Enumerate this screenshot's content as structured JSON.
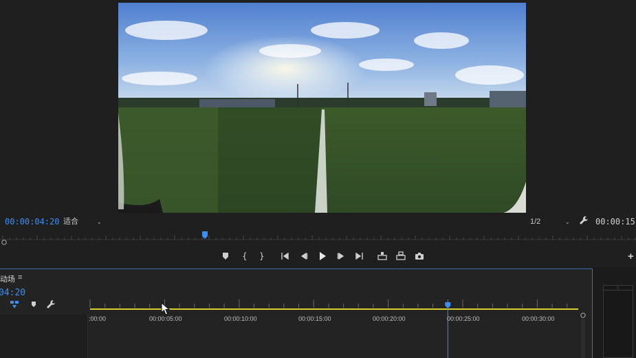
{
  "monitor": {
    "current_timecode": "00:00:04:20",
    "fit_dropdown": "适合",
    "resolution_dropdown": "1/2",
    "duration_timecode": "00:00:15:00",
    "icons": [
      "wrench-icon"
    ]
  },
  "transport": {
    "buttons": [
      "add-marker",
      "mark-in",
      "mark-out",
      "go-to-in",
      "step-back",
      "play",
      "step-forward",
      "go-to-out",
      "lift",
      "extract",
      "export-frame"
    ],
    "add_label": "+"
  },
  "timeline": {
    "sequence_name": "动场",
    "menu_icon": "≡",
    "timecode": "04:20",
    "ruler_labels": [
      ":00:00",
      "00:00:05:00",
      "00:00:10:00",
      "00:00:15:00",
      "00:00:20:00",
      "00:00:25:00",
      "00:00:30:00"
    ],
    "playhead_seconds": 4.8,
    "work_area_seconds": [
      0,
      15
    ]
  },
  "colors": {
    "accent_blue": "#3a8ff0",
    "work_area_yellow": "#d8d02a",
    "playhead": "#3a8ff0"
  }
}
